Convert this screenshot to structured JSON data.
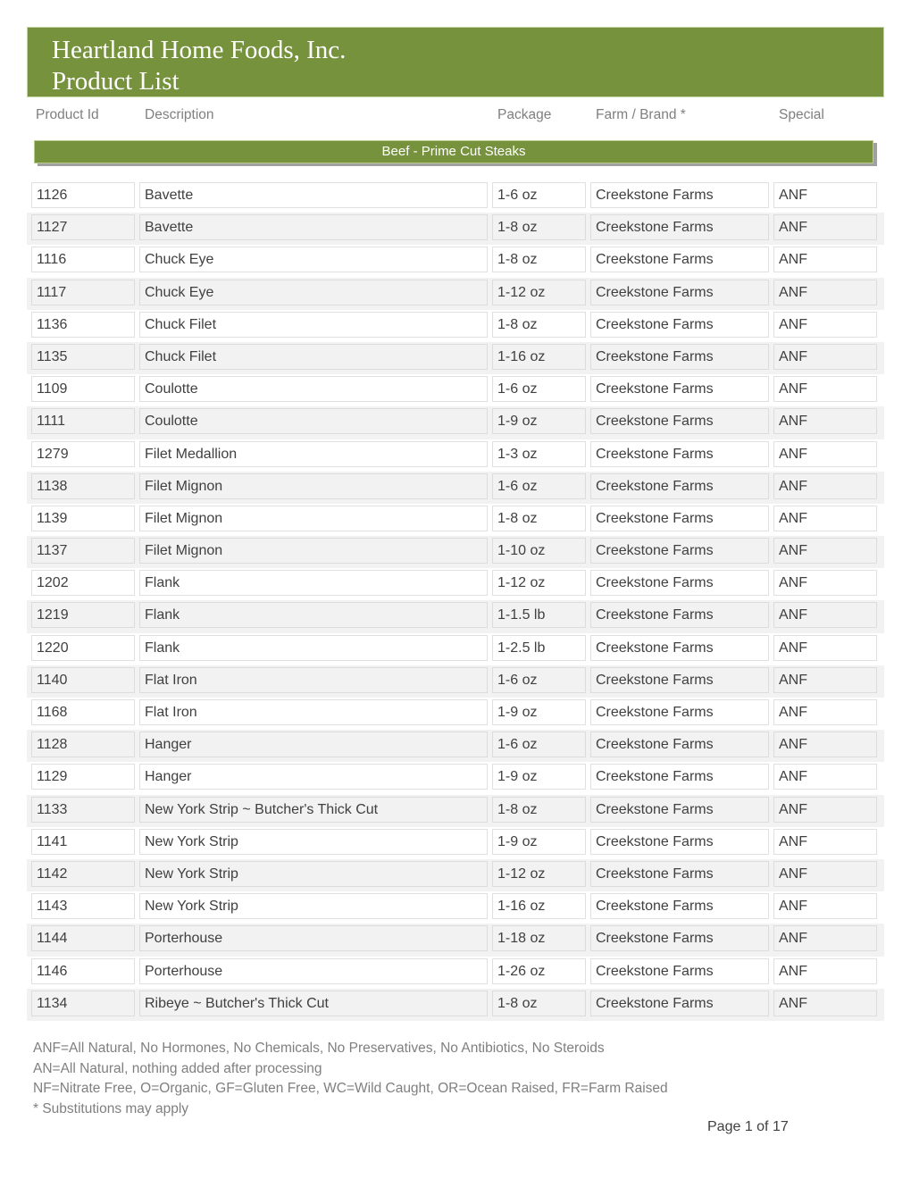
{
  "header": {
    "company": "Heartland Home Foods, Inc.",
    "title": "Product List"
  },
  "columns": [
    "Product Id",
    "Description",
    "Package",
    "Farm / Brand *",
    "Special"
  ],
  "category": "Beef  -  Prime Cut Steaks",
  "rows": [
    [
      "1126",
      "Bavette",
      "1-6 oz",
      "Creekstone Farms",
      "ANF"
    ],
    [
      "1127",
      "Bavette",
      "1-8 oz",
      "Creekstone Farms",
      "ANF"
    ],
    [
      "1116",
      "Chuck Eye",
      "1-8 oz",
      "Creekstone Farms",
      "ANF"
    ],
    [
      "1117",
      "Chuck Eye",
      "1-12 oz",
      "Creekstone Farms",
      "ANF"
    ],
    [
      "1136",
      "Chuck Filet",
      "1-8 oz",
      "Creekstone Farms",
      "ANF"
    ],
    [
      "1135",
      "Chuck Filet",
      "1-16 oz",
      "Creekstone Farms",
      "ANF"
    ],
    [
      "1109",
      "Coulotte",
      "1-6 oz",
      "Creekstone Farms",
      "ANF"
    ],
    [
      "1111",
      "Coulotte",
      "1-9 oz",
      "Creekstone Farms",
      "ANF"
    ],
    [
      "1279",
      "Filet Medallion",
      "1-3 oz",
      "Creekstone Farms",
      "ANF"
    ],
    [
      "1138",
      "Filet Mignon",
      "1-6 oz",
      "Creekstone Farms",
      "ANF"
    ],
    [
      "1139",
      "Filet Mignon",
      "1-8 oz",
      "Creekstone Farms",
      "ANF"
    ],
    [
      "1137",
      "Filet Mignon",
      "1-10 oz",
      "Creekstone Farms",
      "ANF"
    ],
    [
      "1202",
      "Flank",
      "1-12 oz",
      "Creekstone Farms",
      "ANF"
    ],
    [
      "1219",
      "Flank",
      "1-1.5 lb",
      "Creekstone Farms",
      "ANF"
    ],
    [
      "1220",
      "Flank",
      "1-2.5 lb",
      "Creekstone Farms",
      "ANF"
    ],
    [
      "1140",
      "Flat Iron",
      "1-6 oz",
      "Creekstone Farms",
      "ANF"
    ],
    [
      "1168",
      "Flat Iron",
      "1-9 oz",
      "Creekstone Farms",
      "ANF"
    ],
    [
      "1128",
      "Hanger",
      "1-6 oz",
      "Creekstone Farms",
      "ANF"
    ],
    [
      "1129",
      "Hanger",
      "1-9 oz",
      "Creekstone Farms",
      "ANF"
    ],
    [
      "1133",
      "New York Strip ~ Butcher's Thick Cut",
      "1-8 oz",
      "Creekstone Farms",
      "ANF"
    ],
    [
      "1141",
      "New York Strip",
      "1-9 oz",
      "Creekstone Farms",
      "ANF"
    ],
    [
      "1142",
      "New York Strip",
      "1-12 oz",
      "Creekstone Farms",
      "ANF"
    ],
    [
      "1143",
      "New York Strip",
      "1-16 oz",
      "Creekstone Farms",
      "ANF"
    ],
    [
      "1144",
      "Porterhouse",
      "1-18 oz",
      "Creekstone Farms",
      "ANF"
    ],
    [
      "1146",
      "Porterhouse",
      "1-26 oz",
      "Creekstone Farms",
      "ANF"
    ],
    [
      "1134",
      "Ribeye ~ Butcher's Thick Cut",
      "1-8 oz",
      "Creekstone Farms",
      "ANF"
    ]
  ],
  "notes": [
    "ANF=All Natural, No Hormones, No Chemicals, No Preservatives, No Antibiotics, No Steroids",
    "AN=All Natural, nothing added after processing",
    "NF=Nitrate Free, O=Organic, GF=Gluten Free, WC=Wild Caught, OR=Ocean Raised, FR=Farm Raised",
    "* Substitutions may apply"
  ],
  "page": "Page 1 of 17",
  "colors": {
    "accent": "#76923c",
    "row_alt": "#f2f2f2"
  }
}
